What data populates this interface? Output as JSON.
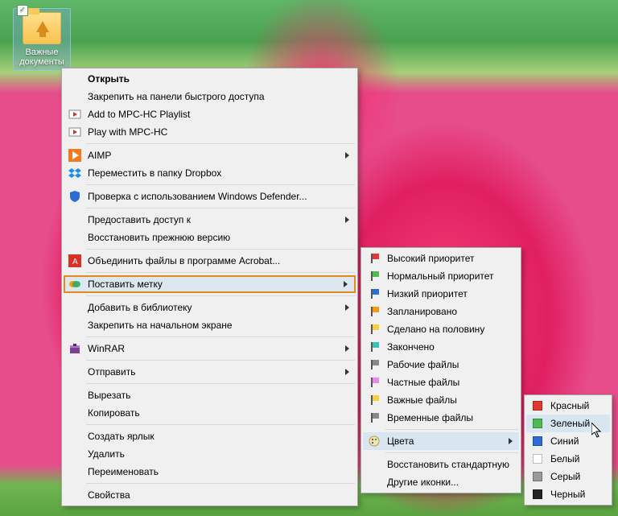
{
  "desktop": {
    "icon_label": "Важные документы"
  },
  "menu1": {
    "open": "Открыть",
    "pin_quick": "Закрепить на панели быстрого доступа",
    "add_mpc": "Add to MPC-HC Playlist",
    "play_mpc": "Play with MPC-HC",
    "aimp": "AIMP",
    "dropbox": "Переместить в папку Dropbox",
    "defender": "Проверка с использованием Windows Defender...",
    "grant_access": "Предоставить доступ к",
    "restore_prev": "Восстановить прежнюю версию",
    "acrobat": "Объединить файлы в программе Acrobat...",
    "tag": "Поставить метку",
    "library": "Добавить в библиотеку",
    "pin_start": "Закрепить на начальном экране",
    "winrar": "WinRAR",
    "send_to": "Отправить",
    "cut": "Вырезать",
    "copy": "Копировать",
    "shortcut": "Создать ярлык",
    "delete": "Удалить",
    "rename": "Переименовать",
    "properties": "Свойства"
  },
  "menu2": {
    "high": "Высокий приоритет",
    "normal": "Нормальный приоритет",
    "low": "Низкий приоритет",
    "planned": "Запланировано",
    "half": "Сделано на половину",
    "done": "Закончено",
    "work": "Рабочие файлы",
    "private": "Частные файлы",
    "important": "Важные файлы",
    "temp": "Временные файлы",
    "colors": "Цвета",
    "restore": "Восстановить стандартную",
    "other": "Другие иконки..."
  },
  "menu3": {
    "red": "Красный",
    "green": "Зеленый",
    "blue": "Синий",
    "white": "Белый",
    "gray": "Серый",
    "black": "Черный"
  }
}
